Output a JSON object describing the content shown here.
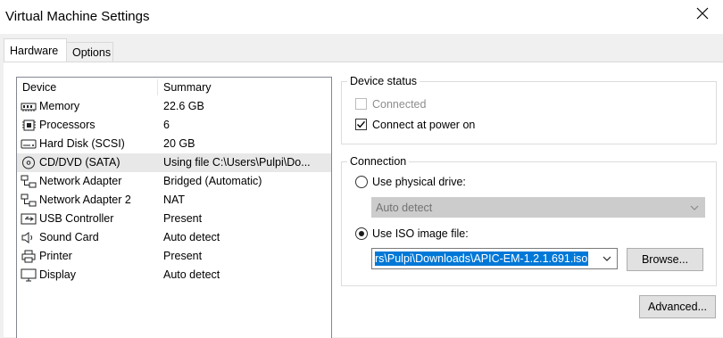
{
  "window": {
    "title": "Virtual Machine Settings"
  },
  "tabs": [
    {
      "label": "Hardware",
      "active": true
    },
    {
      "label": "Options",
      "active": false
    }
  ],
  "device_list": {
    "headers": {
      "device": "Device",
      "summary": "Summary"
    },
    "rows": [
      {
        "icon": "memory-icon",
        "device": "Memory",
        "summary": "22.6 GB"
      },
      {
        "icon": "processor-icon",
        "device": "Processors",
        "summary": "6"
      },
      {
        "icon": "hard-disk-icon",
        "device": "Hard Disk (SCSI)",
        "summary": "20 GB"
      },
      {
        "icon": "cd-dvd-icon",
        "device": "CD/DVD (SATA)",
        "summary": "Using file C:\\Users\\Pulpi\\Do...",
        "selected": true
      },
      {
        "icon": "network-adapter-icon",
        "device": "Network Adapter",
        "summary": "Bridged (Automatic)"
      },
      {
        "icon": "network-adapter-icon",
        "device": "Network Adapter 2",
        "summary": "NAT"
      },
      {
        "icon": "usb-icon",
        "device": "USB Controller",
        "summary": "Present"
      },
      {
        "icon": "speaker-icon",
        "device": "Sound Card",
        "summary": "Auto detect"
      },
      {
        "icon": "printer-icon",
        "device": "Printer",
        "summary": "Present"
      },
      {
        "icon": "display-icon",
        "device": "Display",
        "summary": "Auto detect"
      }
    ]
  },
  "device_status": {
    "legend": "Device status",
    "connected": {
      "label": "Connected",
      "checked": false,
      "enabled": false
    },
    "connect_at_power_on": {
      "label": "Connect at power on",
      "checked": true,
      "enabled": true
    }
  },
  "connection": {
    "legend": "Connection",
    "physical": {
      "label": "Use physical drive:",
      "selected": false
    },
    "physical_drive_value": "Auto detect",
    "iso": {
      "label": "Use ISO image file:",
      "selected": true
    },
    "iso_path": "rs\\Pulpi\\Downloads\\APIC-EM-1.2.1.691.iso",
    "browse_label": "Browse..."
  },
  "advanced_label": "Advanced...",
  "colors": {
    "selection": "#0078d7",
    "selected_row": "#e8e8e8"
  }
}
